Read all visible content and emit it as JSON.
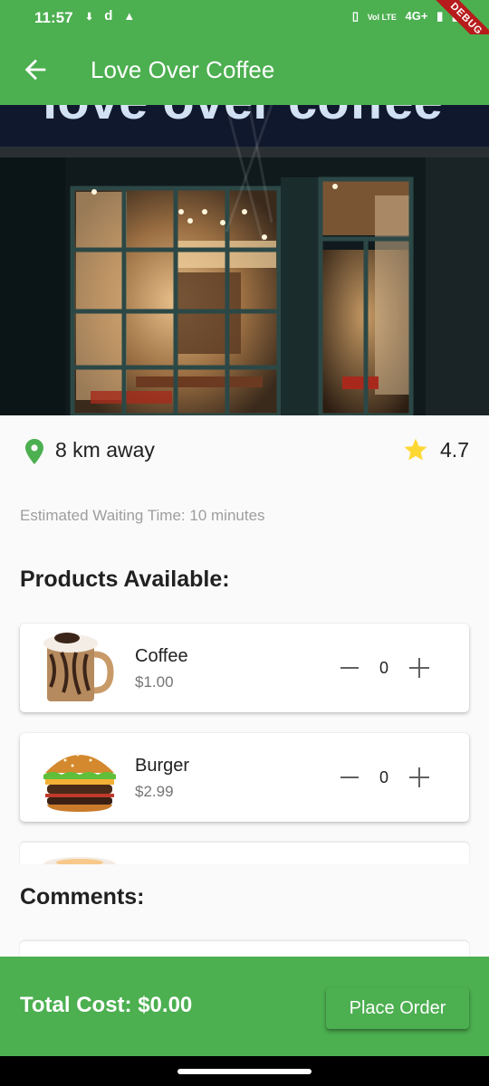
{
  "status_bar": {
    "time": "11:57",
    "left_icons": [
      "download-icon",
      "d",
      "alert-icon"
    ],
    "right_text": [
      "Vol LTE",
      "4G+"
    ],
    "debug_label": "DEBUG"
  },
  "app_bar": {
    "title": "Love Over Coffee",
    "back_icon": "arrow-back-icon"
  },
  "hero": {
    "sign_text": "love over coffee"
  },
  "info": {
    "distance": "8 km away",
    "rating": "4.7"
  },
  "wait_time": "Estimated Waiting Time: 10 minutes",
  "products_title": "Products Available:",
  "products": [
    {
      "name": "Coffee",
      "price": "$1.00",
      "qty": "0"
    },
    {
      "name": "Burger",
      "price": "$2.99",
      "qty": "0"
    }
  ],
  "comments_title": "Comments:",
  "footer": {
    "total": "Total Cost: $0.00",
    "place_order": "Place Order"
  },
  "colors": {
    "primary": "#4caf50",
    "star": "#fdd835"
  }
}
